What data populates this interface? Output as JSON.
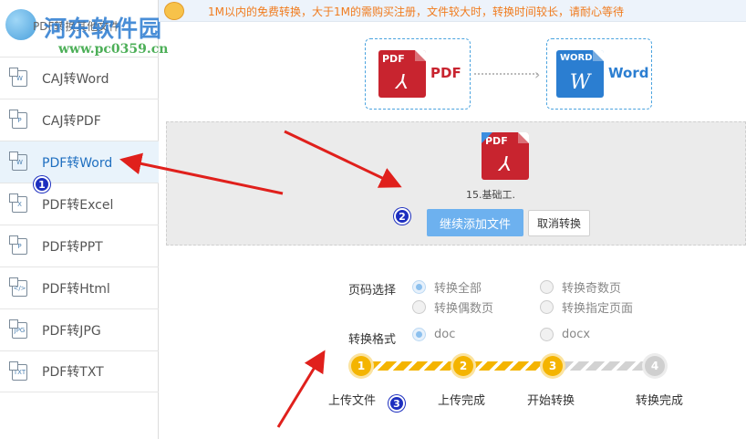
{
  "app": {
    "title": "PDF转换其他文件"
  },
  "watermark": {
    "brand": "河东软件园",
    "url": "www.pc0359.cn"
  },
  "notice": {
    "text": "1M以内的免费转换，大于1M的需购买注册，文件较大时，转换时间较长，请耐心等待"
  },
  "sidebar": {
    "items": [
      {
        "label": "CAJ转Word",
        "icon": "caj-to-word-icon",
        "icon_text": "W"
      },
      {
        "label": "CAJ转PDF",
        "icon": "caj-to-pdf-icon",
        "icon_text": "P"
      },
      {
        "label": "PDF转Word",
        "icon": "pdf-to-word-icon",
        "icon_text": "W",
        "active": true
      },
      {
        "label": "PDF转Excel",
        "icon": "pdf-to-excel-icon",
        "icon_text": "X"
      },
      {
        "label": "PDF转PPT",
        "icon": "pdf-to-ppt-icon",
        "icon_text": "P"
      },
      {
        "label": "PDF转Html",
        "icon": "pdf-to-html-icon",
        "icon_text": "</>"
      },
      {
        "label": "PDF转JPG",
        "icon": "pdf-to-jpg-icon",
        "icon_text": "JPG"
      },
      {
        "label": "PDF转TXT",
        "icon": "pdf-to-txt-icon",
        "icon_text": "TXT"
      }
    ]
  },
  "flow": {
    "from": {
      "icon_text": "PDF",
      "label": "PDF"
    },
    "to": {
      "icon_text": "WORD",
      "label": "Word"
    }
  },
  "dropzone": {
    "file": {
      "icon_text": "PDF",
      "name": "15.基础工."
    },
    "add_button": "继续添加文件",
    "cancel_button": "取消转换"
  },
  "options": {
    "page_label": "页码选择",
    "page_options": [
      "转换全部",
      "转换奇数页",
      "转换偶数页",
      "转换指定页面"
    ],
    "page_selected": "转换全部",
    "format_label": "转换格式",
    "format_options": [
      "doc",
      "docx"
    ],
    "format_selected": "doc"
  },
  "progress": {
    "steps": [
      {
        "number": "1",
        "label": "上传文件"
      },
      {
        "number": "2",
        "label": "上传完成"
      },
      {
        "number": "3",
        "label": "开始转换"
      },
      {
        "number": "4",
        "label": "转换完成"
      }
    ],
    "completed_steps": 3
  },
  "annotations": {
    "markers": [
      "1",
      "2",
      "3"
    ]
  },
  "colors": {
    "accent": "#2b7ed1",
    "pdf": "#c8242f",
    "progress": "#f4b400",
    "notice": "#f07b1e",
    "annotation_arrow": "#e0201c"
  }
}
